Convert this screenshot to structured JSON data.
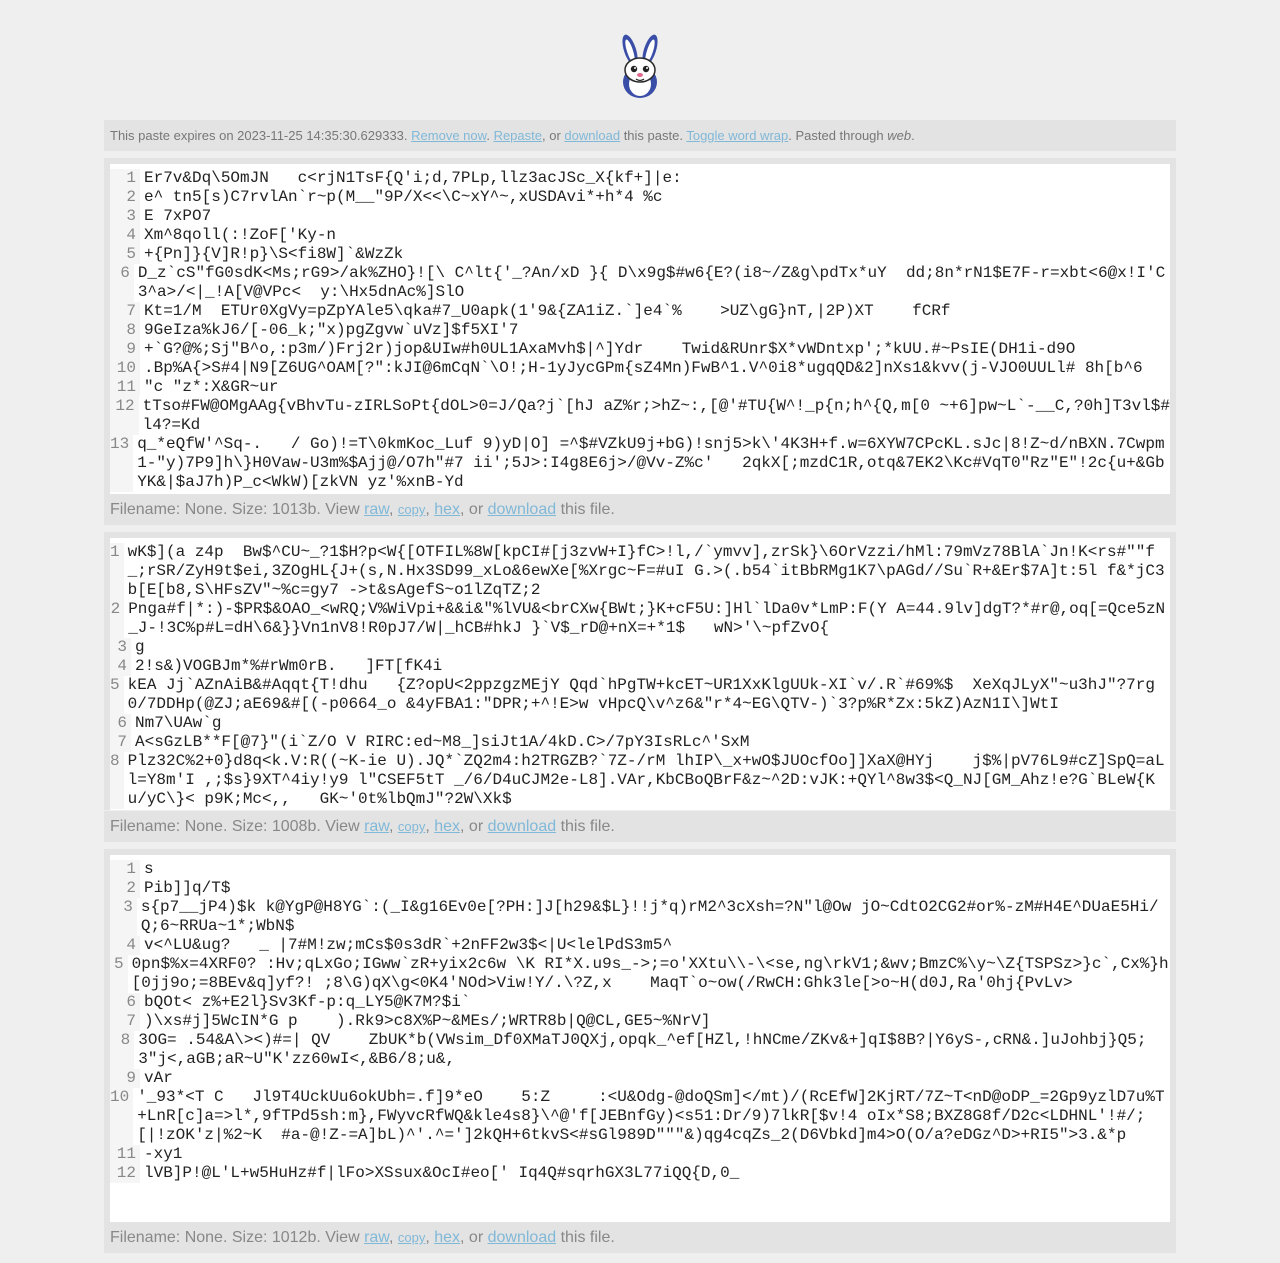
{
  "meta": {
    "text_expires": "This paste expires on 2023-11-25 14:35:30.629333.",
    "remove_now": "Remove now",
    "repaste": "Repaste",
    "text_or": ", or",
    "download": "download",
    "text_this_paste": "this paste.",
    "toggle_wrap": "Toggle word wrap",
    "text_pasted_through": ". Pasted through",
    "pasted_via": "web",
    "text_end": "."
  },
  "files": [
    {
      "lines": [
        {
          "n": "1",
          "text": "Er7v&Dq\\5OmJN   c<rjN1TsF{Q'i;d,7PLp,llz3acJSc_X{kf+]|e:"
        },
        {
          "n": "2",
          "text": "e^ tn5[s)C7rvlAn`r~p(M__\"9P/X<<\\C~xY^~,xUSDAvi*+h*4 %c"
        },
        {
          "n": "3",
          "text": "E 7xPO7"
        },
        {
          "n": "4",
          "text": "Xm^8qoll(:!ZoF['Ky-n"
        },
        {
          "n": "5",
          "text": "+{Pn]}{V]R!p}\\S<fi8W]`&WzZk"
        },
        {
          "n": "6",
          "text": "D_z`cS\"fG0sdK<Ms;rG9>/ak%ZHO}![\\ C^lt{'_?An/xD }{ D\\x9g$#w6{E?(i8~/Z&g\\pdTx*uY  dd;8n*rN1$E7F-r=xbt<6@x!I'C3^a>/<|_!A[V@VPc<  y:\\Hx5dnAc%]SlO"
        },
        {
          "n": "7",
          "text": "Kt=1/M  ETUr0XgVy=pZpYAle5\\qka#7_U0apk(1'9&{ZA1iZ.`]e4`%    >UZ\\gG}nT,|2P)XT    fCRf"
        },
        {
          "n": "8",
          "text": "9GeIza%kJ6/[-06_k;\"x)pgZgvw`uVz]$f5XI'7"
        },
        {
          "n": "9",
          "text": "+`G?@%;Sj\"B^o,:p3m/)Frj2r)jop&UIw#h0UL1AxaMvh$|^]Ydr    Twid&RUnr$X*vWDntxp';*kUU.#~PsIE(DH1i-d9O"
        },
        {
          "n": "10",
          "text": ".Bp%A{>S#4|N9[Z6UG^OAM[?\":kJI@6mCqN`\\O!;H-1yJycGPm{sZ4Mn)FwB^1.V^0i8*ugqQD&2]nXs1&kvv(j-VJO0UULl# 8h[b^6"
        },
        {
          "n": "11",
          "text": "\"c \"z*:X&GR~ur"
        },
        {
          "n": "12",
          "text": "tTso#FW@OMgAAg{vBhvTu-zIRLSoPt{dOL>0=J/Qa?j`[hJ aZ%r;>hZ~:,[@'#TU{W^!_p{n;h^{Q,m[0 ~+6]pw~L`-__C,?0h]T3vl$#l4?=Kd"
        },
        {
          "n": "13",
          "text": "q_*eQfW'^Sq-.   / Go)!=T\\0kmKoc_Luf 9)yD|O] =^$#VZkU9j+bG)!snj5>k\\'4K3H+f.w=6XYW7CPcKL.sJc|8!Z~d/nBXN.7Cwpm1-\"y)7P9]h\\}H0Vaw-U3m%$Ajj@/O7h\"#7 ii';5J>:I4g8E6j>/@Vv-Z%c'   2qkX[;mzdC1R,otq&7EK2\\Kc#VqT0\"Rz\"E\"!2c{u+&GbYK&|$aJ7h)P_c<WkW)[zkVN yz'%xnB-Yd"
        }
      ],
      "footer": {
        "text_info": "Filename: None. Size: 1013b. View",
        "raw": "raw",
        "copy": "copy",
        "hex": "hex",
        "text_or": ", or",
        "download": "download",
        "text_end": "this file."
      }
    },
    {
      "lines": [
        {
          "n": "1",
          "text": "wK$](a z4p  Bw$^CU~_?1$H?p<W{[OTFIL%8W[kpCI#[j3zvW+I}fC>!l,/`ymvv],zrSk}\\6OrVzzi/hMl:79mVz78BlA`Jn!K<rs#\"\"f_;rSR/ZyH9t$ei,3ZOgHL{J+(s,N.Hx3SD99_xLo&6ewXe[%Xrgc~F=#uI G.>(.b54`itBbRMg1K7\\pAGd//Su`R+&Er$7A]t:5l f&*jC3b[E[b8,S\\HFsZV\"~%c=gy7 ->t&sAgefS~o1lZqTZ;2"
        },
        {
          "n": "2",
          "text": "Pnga#f|*:)-$PR$&OAO_<wRQ;V%WiVpi+&&i&\"%lVU&<brCXw{BWt;}K+cF5U:]Hl`lDa0v*LmP:F(Y A=44.9lv]dgT?*#r@,oq[=Qce5zN_J-!3C%p#L=dH\\6&}}Vn1nV8!R0pJ7/W|_hCB#hkJ }`V$_rD@+nX=+*1$   wN>'\\~pfZvO{"
        },
        {
          "n": "3",
          "text": "g"
        },
        {
          "n": "4",
          "text": "2!s&)VOGBJm*%#rWm0rB.   ]FT[fK4i"
        },
        {
          "n": "5",
          "text": "kEA Jj`AZnAiB&#Aqqt{T!dhu   {Z?opU<2ppzgzMEjY Qqd`hPgTW+kcET~UR1XxKlgUUk-XI`v/.R`#69%$  XeXqJLyX\"~u3hJ\"?7rg0/7DDHp(@ZJ;aE69&#[(-p0664_o &4yFBA1:\"DPR;+^!E>w vHpcQ\\v^z6&\"r*4~EG\\QTV-)`3?p%R*Zx:5kZ)AzN1I\\]WtI"
        },
        {
          "n": "6",
          "text": "Nm7\\UAw`g"
        },
        {
          "n": "7",
          "text": "A<sGzLB**F[@7}\"(i`Z/O V RIRC:ed~M8_]siJt1A/4kD.C>/7pY3IsRLc^'SxM"
        },
        {
          "n": "8",
          "text": "Plz32C%2+0}d8q<k.V:R((~K-ie U).JQ*`ZQ2m4:h2TRGZB?`7Z-/rM lhIP\\_x+wO$JUOcfOo]]XaX@HYj    j$%|pV76L9#cZ]SpQ=aL    l=Y8m'I ,;$s}9XT^4iy!y9 l\"CSEF5tT _/6/D4uCJM2e-L8].VAr,KbCBoQBrF&z~^2D:vJK:+QYl^8w3$<Q_NJ[GM_Ahz!e?G`BLeW{Ku/yC\\}< p9K;Mc<,,   GK~'0t%lbQmJ\"?2W\\Xk$"
        }
      ],
      "footer": {
        "text_info": "Filename: None. Size: 1008b. View",
        "raw": "raw",
        "copy": "copy",
        "hex": "hex",
        "text_or": ", or",
        "download": "download",
        "text_end": "this file."
      }
    },
    {
      "lines": [
        {
          "n": "1",
          "text": "s"
        },
        {
          "n": "2",
          "text": "Pib]]q/T$"
        },
        {
          "n": "3",
          "text": "s{p7__jP4)$k k@YgP@H8YG`:(_I&g16Ev0e[?PH:]J[h29&$L}!!j*q)rM2^3cXsh=?N\"l@Ow jO~CdtO2CG2#or%-zM#H4E^DUaE5Hi/Q;6~RRUa~1*;WbN$"
        },
        {
          "n": "4",
          "text": "v<^LU&ug?   _ |7#M!zw;mCs$0s3dR`+2nFF2w3$<|U<lelPdS3m5^"
        },
        {
          "n": "5",
          "text": "0pn$%x=4XRF0? :Hv;qLxGo;IGww`zR+yix2c6w \\K RI*X.u9s_->;=o'XXtu\\\\-\\<se,ng\\rkV1;&wv;BmzC%\\y~\\Z{TSPSz>}c`,Cx%}h[0jj9o;=8BEv&q]yf?! ;8\\G)qX\\g<0K4'NOd>Viw!Y/.\\?Z,x    MaqT`o~ow(/RwCH:Ghk3le[>o~H(d0J,Ra'0hj{PvLv>"
        },
        {
          "n": "6",
          "text": "bQOt< z%+E2l}Sv3Kf-p:q_LY5@K7M?$i`"
        },
        {
          "n": "7",
          "text": ")\\xs#j]5WcIN*G p    ).Rk9>c8X%P~&MEs/;WRTR8b|Q@CL,GE5~%NrV]"
        },
        {
          "n": "8",
          "text": "3OG= .54&A\\><)#=| QV    ZbUK*b(VWsim_Df0XMaTJ0QXj,opqk_^ef[HZl,!hNCme/ZKv&+]qI$8B?|Y6yS-,cRN&.]uJohbj}Q5;3\"j<,aGB;aR~U\"K'zz60wI<,&B6/8;u&,"
        },
        {
          "n": "9",
          "text": "vAr"
        },
        {
          "n": "10",
          "text": "'_93*<T C   Jl9T4UckUu6okUbh=.f]9*eO    5:Z     :<U&Odg-@doQSm]</mt)/(RcEfW]2KjRT/7Z~T<nD@oDP_=2Gp9yzlD7u%T+LnR[c]a=>l*,9fTPd5sh:m},FWyvcRfWQ&kle4s8}\\^@'f[JEBnfGy)<s51:Dr/9)7lkR[$v!4 oIx*S8;BXZ8G8f/D2c<LDHNL'!#/;[|!zOK'z|%2~K  #a-@!Z-=A]bL)^'.^=']2kQH+6tkvS<#sGl989D\"\"\"&)qg4cqZs_2(D6Vbkd]m4>O(O/a?eDGz^D>+RI5\">3.&*p"
        },
        {
          "n": "11",
          "text": "-xy1"
        },
        {
          "n": "12",
          "text": "lVB]P!@L'L+w5HuHz#f|lFo>XSsux&OcI#eo[' Iq4Q#sqrhGX3L77iQQ{D,0_"
        }
      ],
      "footer": {
        "text_info": "Filename: None. Size: 1012b. View",
        "raw": "raw",
        "copy": "copy",
        "hex": "hex",
        "text_or": ", or",
        "download": "download",
        "text_end": "this file."
      }
    }
  ]
}
